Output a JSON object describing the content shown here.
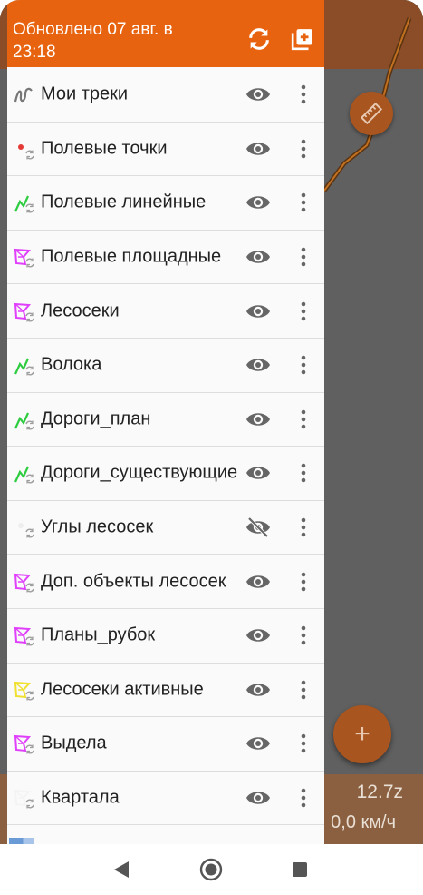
{
  "header": {
    "title": "Обновлено 07 авг. в 23:18",
    "refresh_icon": "refresh-icon",
    "add_layer_icon": "add-layer-icon"
  },
  "layers": [
    {
      "label": "Мои треки",
      "icon": "track-icon",
      "visible": true
    },
    {
      "label": "Полевые точки",
      "icon": "points-sync-icon",
      "visible": true
    },
    {
      "label": "Полевые линейные",
      "icon": "line-sync-icon",
      "visible": true
    },
    {
      "label": "Полевые площадные",
      "icon": "polygon-sync-icon",
      "visible": true
    },
    {
      "label": "Лесосеки",
      "icon": "polygon-sync-icon",
      "visible": true
    },
    {
      "label": "Волока",
      "icon": "line-sync-icon",
      "visible": true
    },
    {
      "label": "Дороги_план",
      "icon": "line-sync-icon",
      "visible": true
    },
    {
      "label": "Дороги_существующие",
      "icon": "line-sync-icon",
      "visible": true
    },
    {
      "label": "Углы лесосек",
      "icon": "points-sync-icon",
      "visible": false
    },
    {
      "label": "Доп. объекты лесосек",
      "icon": "polygon-sync-icon",
      "visible": true
    },
    {
      "label": "Планы_рубок",
      "icon": "polygon-sync-icon",
      "visible": true
    },
    {
      "label": "Лесосеки активные",
      "icon": "polygon-sync-icon",
      "visible": true
    },
    {
      "label": "Выдела",
      "icon": "polygon-sync-icon",
      "visible": true
    },
    {
      "label": "Квартала",
      "icon": "polygon-sync-icon",
      "visible": true
    }
  ],
  "map": {
    "zoom": "12.7z",
    "speed": "0,0 км/ч"
  },
  "colors": {
    "accent": "#e8630f",
    "line_green": "#2ecc40",
    "polygon_magenta": "#e040fb",
    "polygon_yellow": "#f0e030",
    "point_red": "#e53935"
  },
  "navbar": {
    "back_icon": "back-icon",
    "home_icon": "home-icon",
    "recent_icon": "recent-apps-icon"
  }
}
